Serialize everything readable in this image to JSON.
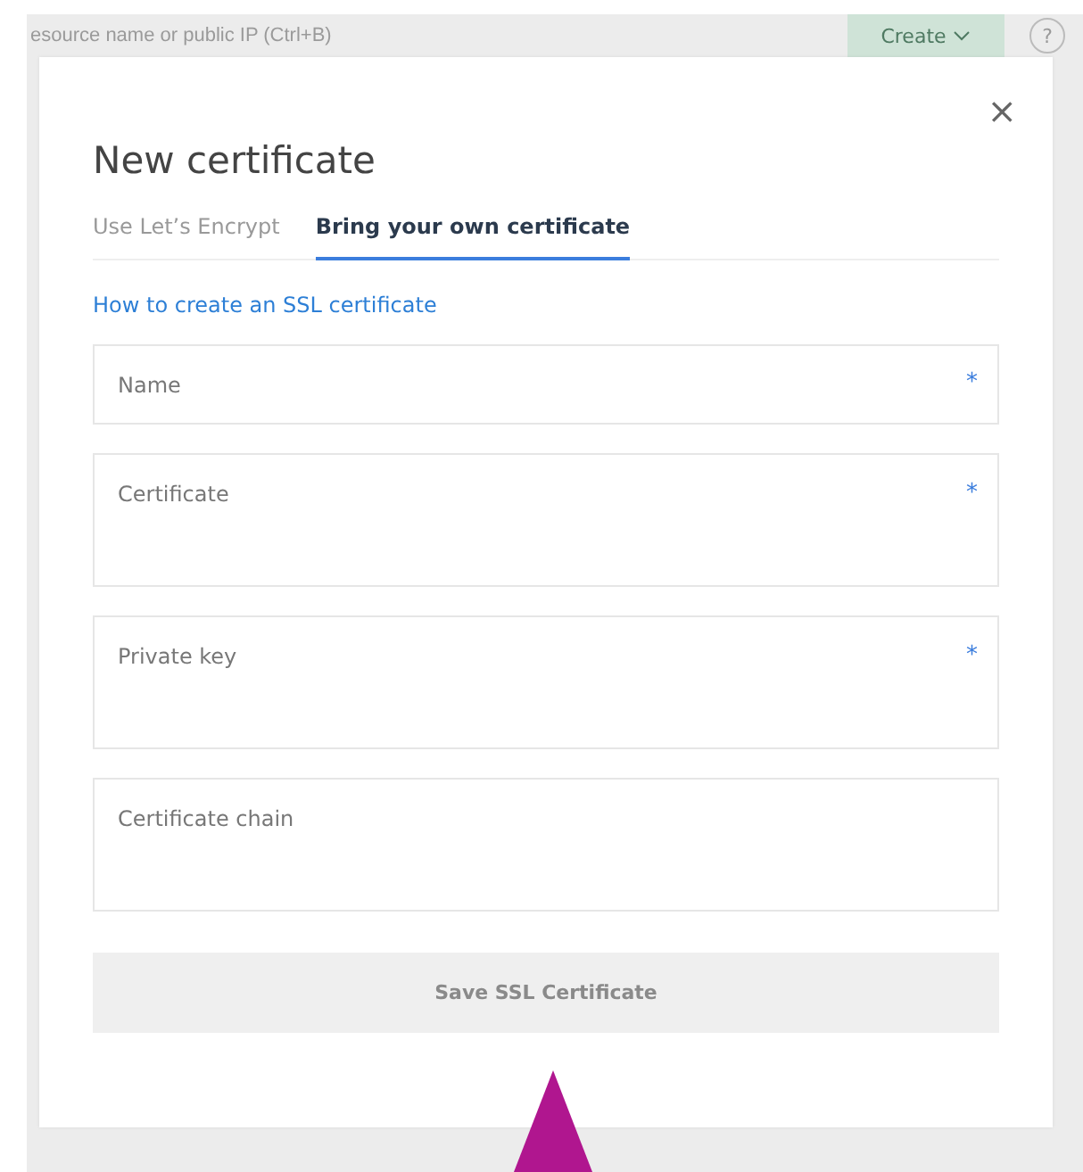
{
  "background": {
    "search": {
      "placeholder": "esource name or public IP (Ctrl+B)"
    },
    "create_button": {
      "label": "Create"
    },
    "help": {
      "label": "?"
    }
  },
  "dialog": {
    "title": "New certificate",
    "close": "×",
    "tabs": [
      {
        "label": "Use Let’s Encrypt",
        "selected": false
      },
      {
        "label": "Bring your own certificate",
        "selected": true
      }
    ],
    "link": "How to create an SSL certificate",
    "required_mark": "*",
    "fields": [
      {
        "kind": "input",
        "placeholder": "Name",
        "required": true
      },
      {
        "kind": "textarea",
        "placeholder": "Certificate",
        "required": true
      },
      {
        "kind": "textarea",
        "placeholder": "Private key",
        "required": true
      },
      {
        "kind": "textarea",
        "placeholder": "Certificate chain",
        "required": false
      }
    ],
    "submit": {
      "label": "Save SSL Certificate",
      "disabled": true
    }
  }
}
